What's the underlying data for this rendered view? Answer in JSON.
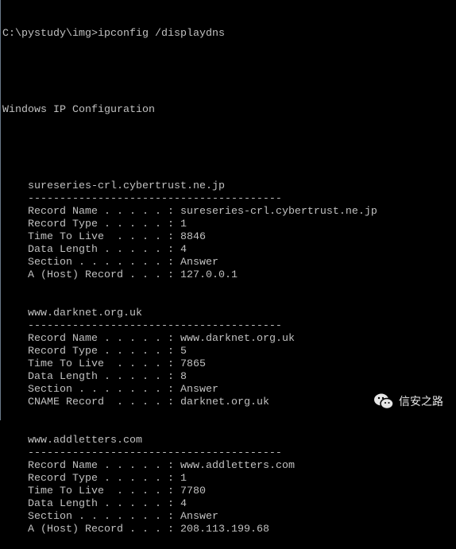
{
  "console": {
    "prompt": "C:\\pystudy\\img>ipconfig /displaydns",
    "heading": "Windows IP Configuration",
    "entries": [
      {
        "name": "sureseries-crl.cybertrust.ne.jp",
        "separator": "----------------------------------------",
        "records": [
          {
            "label": "Record Name . . . . .",
            "value": "sureseries-crl.cybertrust.ne.jp"
          },
          {
            "label": "Record Type . . . . .",
            "value": "1"
          },
          {
            "label": "Time To Live  . . . .",
            "value": "8846"
          },
          {
            "label": "Data Length . . . . .",
            "value": "4"
          },
          {
            "label": "Section . . . . . . .",
            "value": "Answer"
          },
          {
            "label": "A (Host) Record . . .",
            "value": "127.0.0.1"
          }
        ]
      },
      {
        "name": "www.darknet.org.uk",
        "separator": "----------------------------------------",
        "records": [
          {
            "label": "Record Name . . . . .",
            "value": "www.darknet.org.uk"
          },
          {
            "label": "Record Type . . . . .",
            "value": "5"
          },
          {
            "label": "Time To Live  . . . .",
            "value": "7865"
          },
          {
            "label": "Data Length . . . . .",
            "value": "8"
          },
          {
            "label": "Section . . . . . . .",
            "value": "Answer"
          },
          {
            "label": "CNAME Record  . . . .",
            "value": "darknet.org.uk"
          }
        ]
      },
      {
        "name": "www.addletters.com",
        "separator": "----------------------------------------",
        "records": [
          {
            "label": "Record Name . . . . .",
            "value": "www.addletters.com"
          },
          {
            "label": "Record Type . . . . .",
            "value": "1"
          },
          {
            "label": "Time To Live  . . . .",
            "value": "7780"
          },
          {
            "label": "Data Length . . . . .",
            "value": "4"
          },
          {
            "label": "Section . . . . . . .",
            "value": "Answer"
          },
          {
            "label": "A (Host) Record . . .",
            "value": "208.113.199.68"
          }
        ]
      }
    ]
  },
  "watermark": {
    "icon": "wechat-icon",
    "text": "信安之路"
  },
  "colors": {
    "background": "#000000",
    "text": "#c0c0c0"
  }
}
